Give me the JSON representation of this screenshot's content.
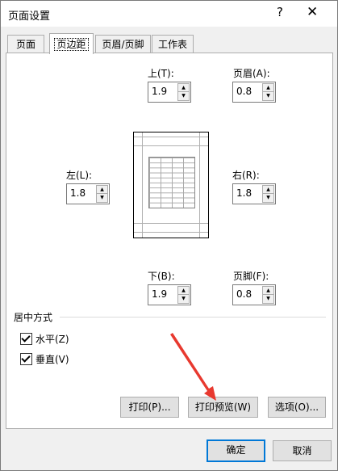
{
  "window": {
    "title": "页面设置",
    "help": "?",
    "close": "✕"
  },
  "tabs": [
    {
      "label": "页面"
    },
    {
      "label": "页边距"
    },
    {
      "label": "页眉/页脚"
    },
    {
      "label": "工作表"
    }
  ],
  "margins": {
    "top": {
      "label": "上(T):",
      "value": "1.9"
    },
    "header": {
      "label": "页眉(A):",
      "value": "0.8"
    },
    "left": {
      "label": "左(L):",
      "value": "1.8"
    },
    "right": {
      "label": "右(R):",
      "value": "1.8"
    },
    "bottom": {
      "label": "下(B):",
      "value": "1.9"
    },
    "footer": {
      "label": "页脚(F):",
      "value": "0.8"
    }
  },
  "center": {
    "title": "居中方式",
    "horizontal": {
      "label": "水平(Z)",
      "checked": true
    },
    "vertical": {
      "label": "垂直(V)",
      "checked": true
    }
  },
  "buttons": {
    "print": "打印(P)...",
    "preview": "打印预览(W)",
    "options": "选项(O)...",
    "ok": "确定",
    "cancel": "取消"
  },
  "colors": {
    "annotation_arrow": "#e8392f",
    "accent": "#0078d7"
  }
}
